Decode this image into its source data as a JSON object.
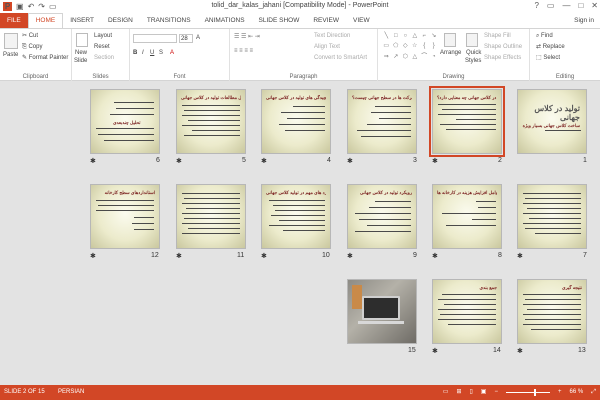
{
  "titlebar": {
    "title": "tolid_dar_kalas_jahani [Compatibility Mode] - PowerPoint",
    "qat_icons": [
      "save-icon",
      "undo-icon",
      "redo-icon",
      "start-slideshow-icon"
    ],
    "controls": [
      "?",
      "▭",
      "—",
      "□",
      "✕"
    ]
  },
  "tabs": [
    {
      "label": "FILE"
    },
    {
      "label": "HOME"
    },
    {
      "label": "INSERT"
    },
    {
      "label": "DESIGN"
    },
    {
      "label": "TRANSITIONS"
    },
    {
      "label": "ANIMATIONS"
    },
    {
      "label": "SLIDE SHOW"
    },
    {
      "label": "REVIEW"
    },
    {
      "label": "VIEW"
    }
  ],
  "signin": "Sign in",
  "ribbon": {
    "clipboard": {
      "paste": "Paste",
      "cut": "Cut",
      "copy": "Copy",
      "format_painter": "Format Painter",
      "label": "Clipboard"
    },
    "slides": {
      "new_slide": "New",
      "new_slide2": "Slide",
      "layout": "Layout",
      "reset": "Reset",
      "section": "Section",
      "label": "Slides"
    },
    "font": {
      "size": "28",
      "label": "Font",
      "bold": "B",
      "italic": "I",
      "underline": "U",
      "strike": "S",
      "aa": "A"
    },
    "paragraph": {
      "text_direction": "Text Direction",
      "align_text": "Align Text",
      "convert_smartart": "Convert to SmartArt",
      "label": "Paragraph"
    },
    "drawing": {
      "arrange": "Arrange",
      "quick_styles": "Quick",
      "quick_styles2": "Styles",
      "shape_fill": "Shape Fill",
      "shape_outline": "Shape Outline",
      "shape_effects": "Shape Effects",
      "label": "Drawing"
    },
    "editing": {
      "find": "Find",
      "replace": "Replace",
      "select": "Select",
      "label": "Editing"
    }
  },
  "slides": [
    {
      "num": "1",
      "title": "",
      "big_title": "تولید در کلاس جهانی",
      "sub": "ساخت کلاس جهانی بسیار ویژه"
    },
    {
      "num": "2",
      "title": "تولید در کلاس جهانی چه معنایی دارد؟",
      "selected": true
    },
    {
      "num": "3",
      "title": "رویکرد شرکت ها در سطح جهانی چیست؟"
    },
    {
      "num": "4",
      "title": "تفاوت ها و پیچیدگی های تولید در کلاس جهانی"
    },
    {
      "num": "5",
      "title": "ادامه تحلیل مطالعات تولید در کلاس جهانی"
    },
    {
      "num": "6",
      "title": "تحلیل چندبعدی"
    },
    {
      "num": "7",
      "title": ""
    },
    {
      "num": "8",
      "title": "عوامل افزایش هزینه در کارخانه ها"
    },
    {
      "num": "9",
      "title": "رویکرد تولید در کلاس جهانی"
    },
    {
      "num": "10",
      "title": "رویکرد های مهم در تولید کلاس جهانی"
    },
    {
      "num": "11",
      "title": ""
    },
    {
      "num": "12",
      "title": "استانداردهای سطح کارخانه"
    },
    {
      "num": "13",
      "title": "نتیجه گیری"
    },
    {
      "num": "14",
      "title": "جمع بندی"
    },
    {
      "num": "15",
      "title": "",
      "photo": true
    }
  ],
  "status": {
    "slide_of": "SLIDE 2 OF 15",
    "language": "PERSIAN",
    "zoom": "66 %",
    "zoom_level": 0.66
  },
  "colors": {
    "accent": "#d24726",
    "selected_outline": "#d24726"
  }
}
